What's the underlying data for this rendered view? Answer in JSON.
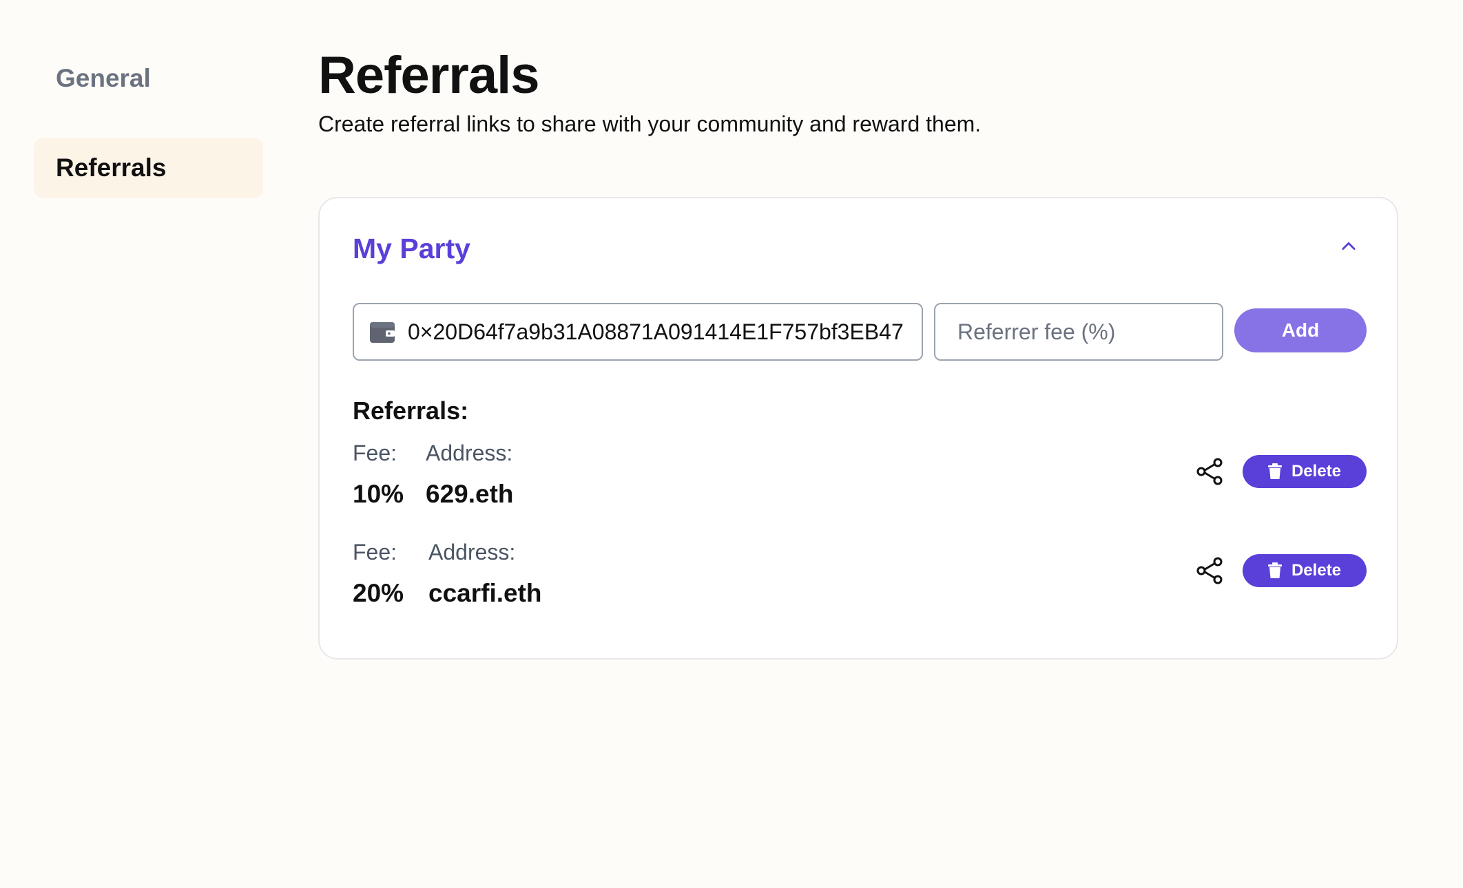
{
  "sidebar": {
    "items": [
      {
        "label": "General"
      },
      {
        "label": "Referrals"
      }
    ]
  },
  "header": {
    "title": "Referrals",
    "subtitle": "Create referral links to share with your community and reward them."
  },
  "card": {
    "title": "My Party",
    "collapse_icon": "chevron-up-icon",
    "wallet_input": {
      "value": "0×20D64f7a9b31A08871A091414E1F757bf3EB47",
      "icon": "wallet-icon"
    },
    "fee_input": {
      "placeholder": "Referrer fee (%)",
      "value": ""
    },
    "add_label": "Add",
    "referrals_heading": "Referrals:",
    "referrals": [
      {
        "fee_label": "Fee:",
        "fee": "10%",
        "address_label": "Address:",
        "address": "629.eth",
        "delete_label": "Delete"
      },
      {
        "fee_label": "Fee:",
        "fee": "20%",
        "address_label": "Address:",
        "address": "ccarfi.eth",
        "delete_label": "Delete"
      }
    ]
  },
  "colors": {
    "accent": "#5b3fd9",
    "accent_light": "#8772e6",
    "active_bg": "#fdf4e8",
    "page_bg": "#fdfcf8"
  }
}
